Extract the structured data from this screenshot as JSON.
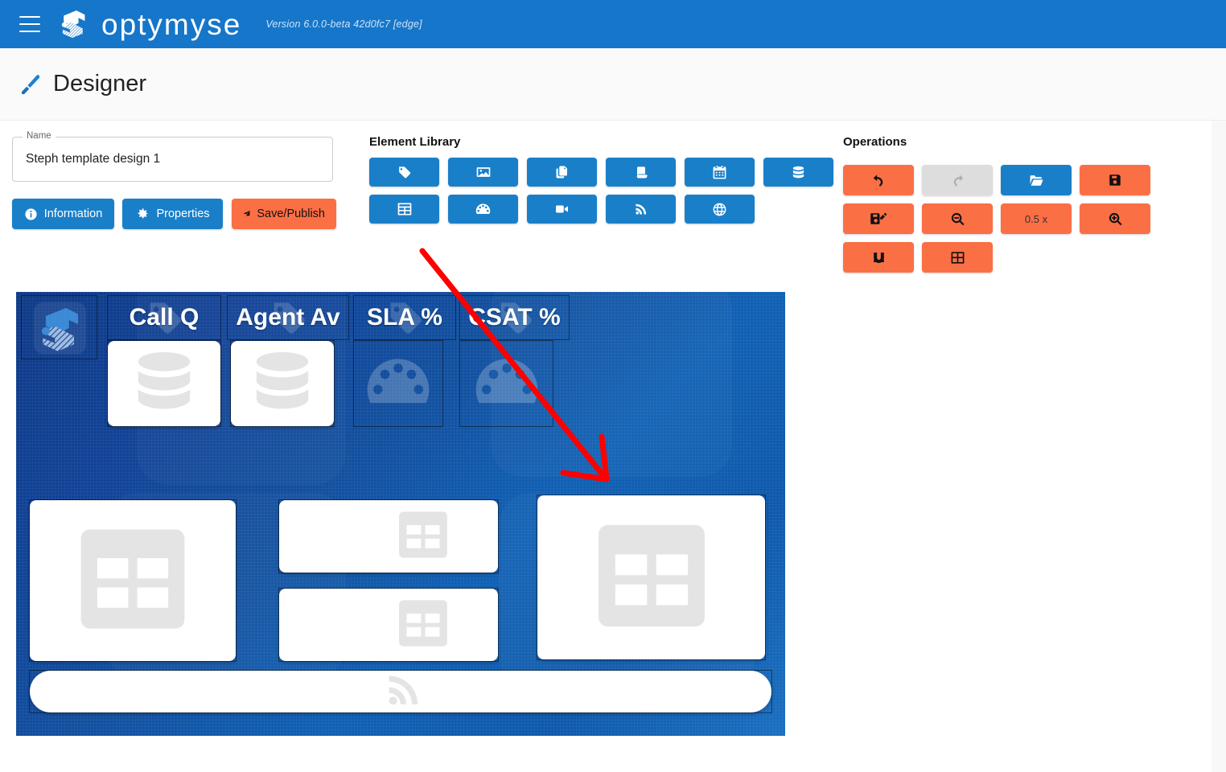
{
  "appbar": {
    "menu_icon": "hamburger-icon",
    "logo_icon": "optymyse-logo-icon",
    "brand": "optymyse",
    "version": "Version 6.0.0-beta 42d0fc7 [edge]",
    "background_color": "#1576ca"
  },
  "titlebar": {
    "icon": "paintbrush-icon",
    "title": "Designer"
  },
  "form": {
    "name_legend": "Name",
    "name_value": "Steph template design 1",
    "name_placeholder": "Name"
  },
  "actions": [
    {
      "id": "information",
      "label": "Information",
      "icon": "info-circle-icon",
      "style": "blue"
    },
    {
      "id": "properties",
      "label": "Properties",
      "icon": "gear-icon",
      "style": "blue"
    },
    {
      "id": "savepublish",
      "label": "Save/Publish",
      "icon": "paper-plane-icon",
      "style": "orange"
    }
  ],
  "element_library": {
    "heading": "Element Library",
    "items": [
      {
        "id": "label",
        "icon": "tag-icon",
        "row": 1,
        "col": 1
      },
      {
        "id": "image",
        "icon": "image-icon",
        "row": 1,
        "col": 2
      },
      {
        "id": "page",
        "icon": "copy-pages-icon",
        "row": 1,
        "col": 3
      },
      {
        "id": "ticker",
        "icon": "scroll-icon",
        "row": 1,
        "col": 4
      },
      {
        "id": "calendar",
        "icon": "calendar-icon",
        "row": 1,
        "col": 5
      },
      {
        "id": "datastack",
        "icon": "database-icon",
        "row": 1,
        "col": 6
      },
      {
        "id": "table",
        "icon": "table-icon",
        "row": 2,
        "col": 1,
        "highlighted": true
      },
      {
        "id": "gauge",
        "icon": "gauge-icon",
        "row": 2,
        "col": 2
      },
      {
        "id": "video",
        "icon": "video-icon",
        "row": 2,
        "col": 3
      },
      {
        "id": "rss",
        "icon": "rss-icon",
        "row": 2,
        "col": 4
      },
      {
        "id": "web",
        "icon": "globe-icon",
        "row": 2,
        "col": 5
      }
    ]
  },
  "operations": {
    "heading": "Operations",
    "zoom_level": "0.5 x",
    "items": [
      {
        "id": "undo",
        "icon": "undo-arrow-icon",
        "style": "orange",
        "row": 1,
        "col": 1
      },
      {
        "id": "redo",
        "icon": "redo-arrow-icon",
        "style": "disabled",
        "row": 1,
        "col": 2
      },
      {
        "id": "open",
        "icon": "folder-open-icon",
        "style": "blue",
        "row": 1,
        "col": 3
      },
      {
        "id": "save",
        "icon": "floppy-save-icon",
        "style": "orange",
        "row": 1,
        "col": 4
      },
      {
        "id": "save-as",
        "icon": "floppy-pencil-icon",
        "style": "orange",
        "row": 2,
        "col": 1
      },
      {
        "id": "zoom-out",
        "icon": "magnifier-minus-icon",
        "style": "orange",
        "row": 2,
        "col": 2
      },
      {
        "id": "zoom-value",
        "label": "0.5 x",
        "style": "orange",
        "row": 2,
        "col": 3
      },
      {
        "id": "zoom-in",
        "icon": "magnifier-plus-icon",
        "style": "orange",
        "row": 2,
        "col": 4
      },
      {
        "id": "snap",
        "icon": "magnet-icon",
        "style": "orange",
        "row": 3,
        "col": 1
      },
      {
        "id": "grid",
        "icon": "grid-toggle-icon",
        "style": "orange",
        "row": 3,
        "col": 2
      }
    ]
  },
  "canvas": {
    "logo_element": {
      "icon": "optymyse-logo-icon"
    },
    "labels": [
      {
        "id": "label-callq",
        "text": "Call Q"
      },
      {
        "id": "label-agentav",
        "text": "Agent Av"
      },
      {
        "id": "label-sla",
        "text": "SLA %"
      },
      {
        "id": "label-csat",
        "text": "CSAT %"
      }
    ],
    "widgets": [
      {
        "id": "widget-callq-stack",
        "type": "database-stack"
      },
      {
        "id": "widget-agentav-stack",
        "type": "database-stack"
      },
      {
        "id": "widget-sla-gauge",
        "type": "gauge"
      },
      {
        "id": "widget-csat-gauge",
        "type": "gauge"
      },
      {
        "id": "widget-table-left",
        "type": "table"
      },
      {
        "id": "widget-table-mid-top",
        "type": "table"
      },
      {
        "id": "widget-table-mid-bot",
        "type": "table"
      },
      {
        "id": "widget-table-right",
        "type": "table"
      },
      {
        "id": "widget-rss-ticker",
        "type": "rss-ticker"
      }
    ]
  },
  "annotation": {
    "highlight_target": "table-element-button",
    "arrow_color": "#ff0000",
    "highlight_color": "#ff0000"
  },
  "colors": {
    "primary_blue": "#1576ca",
    "button_blue": "#1a7fc9",
    "accent_orange": "#fb6f45",
    "disabled_gray": "#dddddd",
    "page_bg": "#f8f8f8"
  }
}
